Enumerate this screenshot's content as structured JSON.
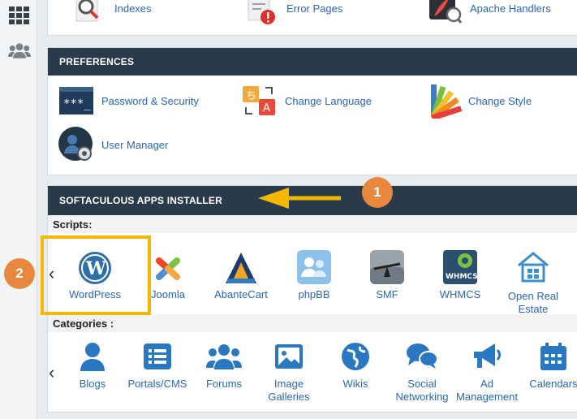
{
  "top_items": [
    {
      "label": "Indexes",
      "icon": "magnifier-icon"
    },
    {
      "label": "Error Pages",
      "icon": "error-document-icon"
    },
    {
      "label": "Apache Handlers",
      "icon": "feather-icon"
    }
  ],
  "preferences": {
    "title": "PREFERENCES",
    "items": [
      {
        "label": "Password & Security",
        "icon": "password-icon"
      },
      {
        "label": "Change Language",
        "icon": "language-icon"
      },
      {
        "label": "Change Style",
        "icon": "palette-icon"
      },
      {
        "label": "User Manager",
        "icon": "user-manager-icon"
      }
    ]
  },
  "softaculous": {
    "title": "SOFTACULOUS APPS INSTALLER",
    "scripts_label": "Scripts:",
    "scripts": [
      "WordPress",
      "Joomla",
      "AbanteCart",
      "phpBB",
      "SMF",
      "WHMCS",
      "Open Real Estate"
    ],
    "whmcs_logo_text": "WHMCS",
    "categories_label": "Categories :",
    "categories": [
      "Blogs",
      "Portals/CMS",
      "Forums",
      "Image Galleries",
      "Wikis",
      "Social Networking",
      "Ad Management",
      "Calendars"
    ]
  },
  "annotations": {
    "step1": "1",
    "step2": "2"
  },
  "colors": {
    "header": "#293a4a",
    "link": "#2b66b2",
    "badge": "#e8873e",
    "highlight": "#f5b800"
  }
}
